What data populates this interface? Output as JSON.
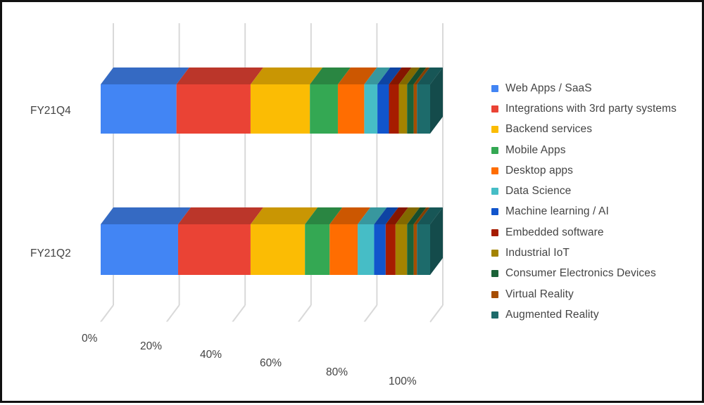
{
  "chart_data": {
    "type": "bar",
    "orientation": "horizontal",
    "stacked": true,
    "percent_stacked": true,
    "three_d": true,
    "title": "",
    "xlabel": "",
    "ylabel": "",
    "xlim": [
      0,
      100
    ],
    "grid": true,
    "legend_position": "right",
    "tick_labels": [
      "0%",
      "20%",
      "40%",
      "60%",
      "80%",
      "100%"
    ],
    "tick_values": [
      0,
      20,
      40,
      60,
      80,
      100
    ],
    "categories": [
      "FY21Q4",
      "FY21Q2"
    ],
    "series": [
      {
        "name": "Web Apps / SaaS",
        "color": "#4285f4",
        "values": [
          23.0,
          23.5
        ]
      },
      {
        "name": "Integrations with 3rd party systems",
        "color": "#ea4335",
        "values": [
          22.5,
          22.0
        ]
      },
      {
        "name": "Backend services",
        "color": "#fbbc04",
        "values": [
          18.0,
          16.5
        ]
      },
      {
        "name": "Mobile Apps",
        "color": "#34a853",
        "values": [
          8.5,
          7.5
        ]
      },
      {
        "name": "Desktop apps",
        "color": "#ff6d01",
        "values": [
          8.0,
          8.5
        ]
      },
      {
        "name": "Data Science",
        "color": "#46bdc6",
        "values": [
          4.0,
          5.0
        ]
      },
      {
        "name": "Machine learning / AI",
        "color": "#1155cc",
        "values": [
          3.5,
          3.5
        ]
      },
      {
        "name": "Embedded software",
        "color": "#a61c00",
        "values": [
          3.0,
          3.0
        ]
      },
      {
        "name": "Industrial IoT",
        "color": "#a38300",
        "values": [
          2.5,
          3.5
        ]
      },
      {
        "name": "Consumer Electronics Devices",
        "color": "#1b6238",
        "values": [
          2.0,
          2.0
        ]
      },
      {
        "name": "Virtual Reality",
        "color": "#a64d00",
        "values": [
          1.0,
          1.0
        ]
      },
      {
        "name": "Augmented Reality",
        "color": "#1d6b6b",
        "values": [
          4.0,
          4.0
        ]
      }
    ]
  },
  "legend": {
    "items": [
      {
        "label": "Web Apps / SaaS",
        "color": "#4285f4"
      },
      {
        "label": "Integrations with 3rd party systems",
        "color": "#ea4335"
      },
      {
        "label": "Backend services",
        "color": "#fbbc04"
      },
      {
        "label": "Mobile Apps",
        "color": "#34a853"
      },
      {
        "label": "Desktop apps",
        "color": "#ff6d01"
      },
      {
        "label": "Data Science",
        "color": "#46bdc6"
      },
      {
        "label": "Machine learning / AI",
        "color": "#1155cc"
      },
      {
        "label": "Embedded software",
        "color": "#a61c00"
      },
      {
        "label": "Industrial IoT",
        "color": "#a38300"
      },
      {
        "label": "Consumer Electronics Devices",
        "color": "#1b6238"
      },
      {
        "label": "Virtual Reality",
        "color": "#a64d00"
      },
      {
        "label": "Augmented Reality",
        "color": "#1d6b6b"
      }
    ]
  },
  "axes": {
    "x_ticks": [
      "0%",
      "20%",
      "40%",
      "60%",
      "80%",
      "100%"
    ],
    "y_categories": [
      "FY21Q4",
      "FY21Q2"
    ]
  },
  "style": {
    "gridline_color": "#d9d9d9",
    "axis_text_color": "#434343",
    "legend_text_color": "#444444",
    "plot_background": "#ffffff",
    "frame_border": "#111111"
  }
}
